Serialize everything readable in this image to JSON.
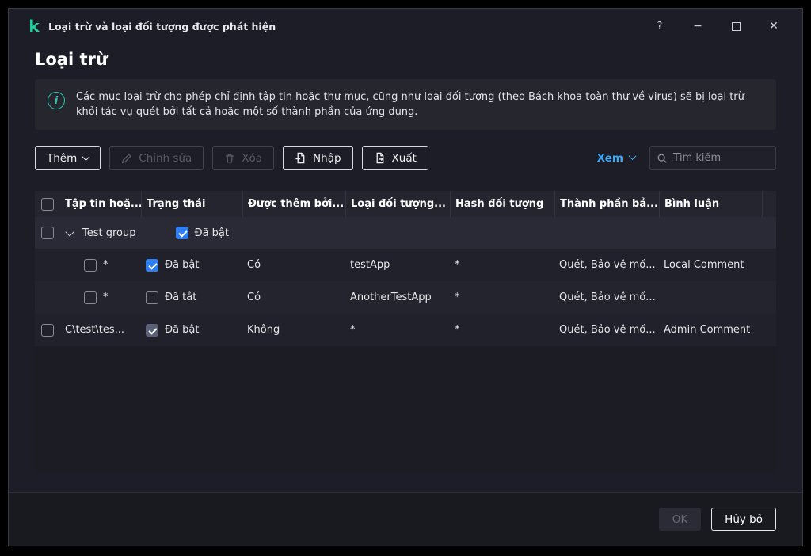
{
  "window": {
    "title": "Loại trừ và loại đối tượng được phát hiện",
    "controls": {
      "help": "?",
      "minimize": "−",
      "close": "✕"
    }
  },
  "page": {
    "title": "Loại trừ",
    "info_text": "Các mục loại trừ cho phép chỉ định tập tin hoặc thư mục, cũng như loại đối tượng (theo Bách khoa toàn thư về virus) sẽ bị loại trừ khỏi tác vụ quét bởi tất cả hoặc một số thành phần của ứng dụng."
  },
  "toolbar": {
    "add_label": "Thêm",
    "edit_label": "Chỉnh sửa",
    "delete_label": "Xóa",
    "import_label": "Nhập",
    "export_label": "Xuất",
    "view_label": "Xem",
    "search_placeholder": "Tìm kiếm"
  },
  "icons": {
    "logo": "kaspersky-logo",
    "info": "info-circle",
    "edit": "pencil",
    "delete": "trash",
    "import": "document-arrow-in",
    "export": "document-arrow-out",
    "search": "magnifier",
    "expand": "chevron-down"
  },
  "colors": {
    "accent_blue": "#2f7ff2",
    "link_blue": "#3fa9f5",
    "brand_green": "#23d1a0",
    "info_teal": "#2fc6b0"
  },
  "table": {
    "headers": [
      "Tập tin hoặ...",
      "Trạng thái",
      "Được thêm bởi...",
      "Loại đối tượng...",
      "Hash đối tượng",
      "Thành phần bả...",
      "Bình luận"
    ],
    "group": {
      "name": "Test group",
      "status": "Đã bật",
      "status_checked": true,
      "selected": false
    },
    "rows": [
      {
        "file": "*",
        "status": "Đã bật",
        "status_checked": true,
        "status_disabled": false,
        "added_by": "Có",
        "object_type": "testApp",
        "hash": "*",
        "component": "Quét, Bảo vệ mố...",
        "comment": "Local Comment",
        "selected": false
      },
      {
        "file": "*",
        "status": "Đã tắt",
        "status_checked": false,
        "status_disabled": false,
        "added_by": "Có",
        "object_type": "AnotherTestApp",
        "hash": "*",
        "component": "Quét, Bảo vệ mố...",
        "comment": "",
        "selected": false
      },
      {
        "file": "C\\test\\tes...",
        "status": "Đã bật",
        "status_checked": true,
        "status_disabled": true,
        "added_by": "Không",
        "object_type": "*",
        "hash": "*",
        "component": "Quét, Bảo vệ mố...",
        "comment": "Admin Comment",
        "selected": false
      }
    ]
  },
  "footer": {
    "ok_label": "OK",
    "cancel_label": "Hủy bỏ"
  }
}
